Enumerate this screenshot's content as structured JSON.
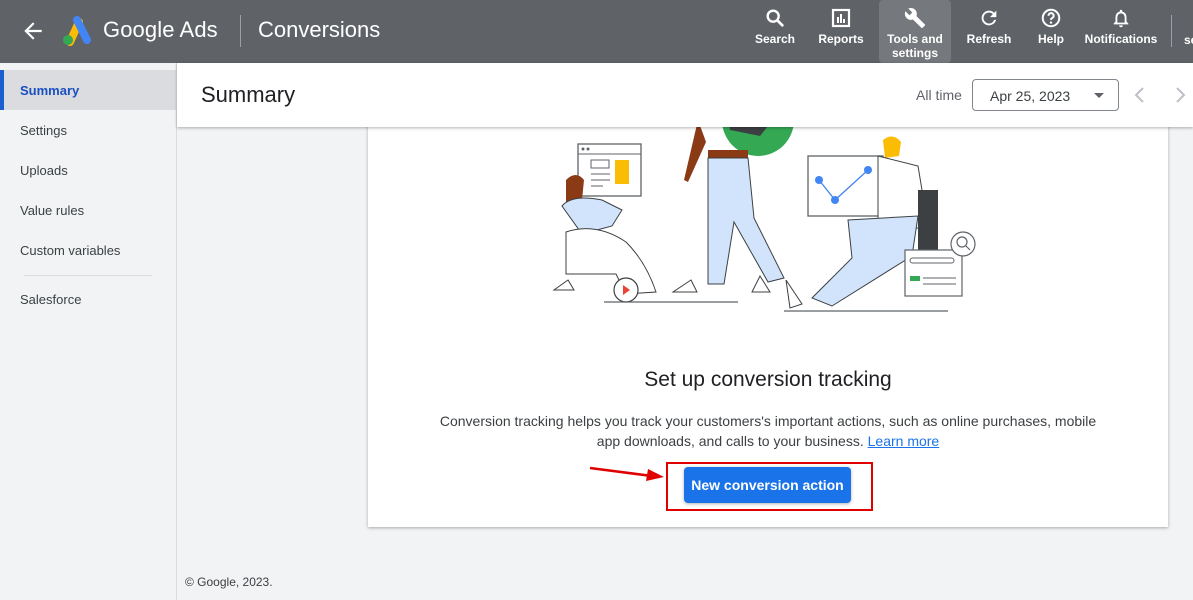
{
  "topbar": {
    "product_name": "Google Ads",
    "page_title": "Conversions",
    "nav": [
      {
        "icon": "search-icon",
        "label": "Search"
      },
      {
        "icon": "reports-icon",
        "label": "Reports"
      },
      {
        "icon": "wrench-icon",
        "label": "Tools and settings",
        "active": true
      },
      {
        "icon": "refresh-icon",
        "label": "Refresh"
      },
      {
        "icon": "help-icon",
        "label": "Help"
      },
      {
        "icon": "bell-icon",
        "label": "Notifications"
      }
    ],
    "cut_off_label": "se"
  },
  "sidebar": {
    "items": [
      {
        "label": "Summary",
        "active": true
      },
      {
        "label": "Settings"
      },
      {
        "label": "Uploads"
      },
      {
        "label": "Value rules"
      },
      {
        "label": "Custom variables"
      },
      {
        "label": "Salesforce"
      }
    ]
  },
  "header": {
    "title": "Summary",
    "range_label": "All time",
    "date_value": "Apr 25, 2023"
  },
  "card": {
    "title": "Set up conversion tracking",
    "description": "Conversion tracking helps you track your customers's important actions, such as online purchases, mobile app downloads, and calls to your business.",
    "learn_more": "Learn more",
    "button_label": "New conversion action"
  },
  "colors": {
    "topbar": "#5f6368",
    "accent": "#1a73e8",
    "annotation": "#e00000",
    "illustration_green": "#34a853",
    "illustration_yellow": "#fbbc04"
  },
  "footer": {
    "copyright": "© Google, 2023."
  }
}
